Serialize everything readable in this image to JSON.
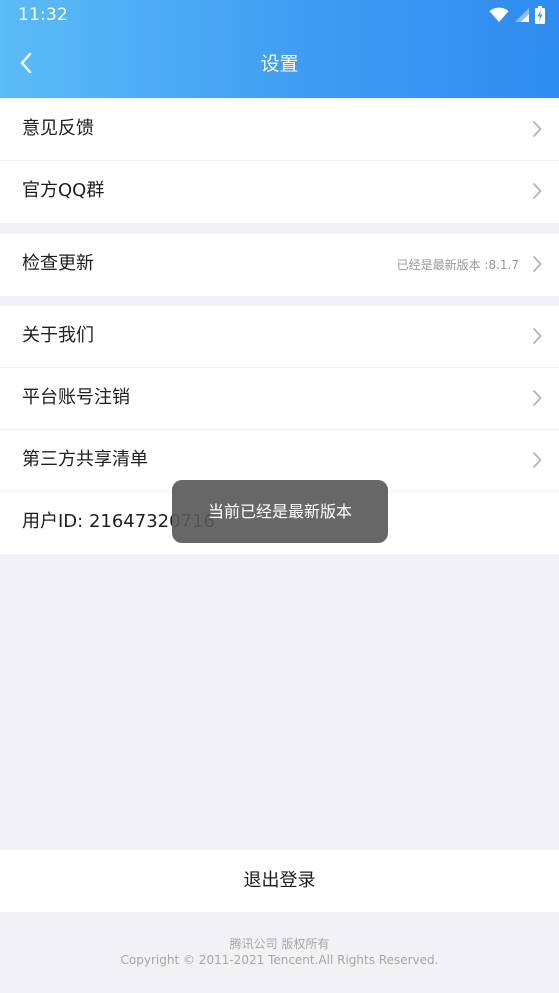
{
  "status_bar": {
    "time": "11:32"
  },
  "header": {
    "title": "设置",
    "back_icon": "chevron-left-icon"
  },
  "groups": [
    {
      "items": [
        {
          "label": "意见反馈"
        },
        {
          "label": "官方QQ群"
        }
      ]
    },
    {
      "items": [
        {
          "label": "检查更新",
          "value": "已经是最新版本 :8.1.7"
        }
      ]
    },
    {
      "items": [
        {
          "label": "关于我们"
        },
        {
          "label": "平台账号注销"
        },
        {
          "label": "第三方共享清单"
        },
        {
          "label": "用户ID: 21647320716"
        }
      ]
    }
  ],
  "logout": {
    "label": "退出登录"
  },
  "footer": {
    "line1": "腾讯公司 版权所有",
    "line2": "Copyright © 2011-2021 Tencent.All Rights Reserved."
  },
  "toast": {
    "message": "当前已经是最新版本"
  },
  "colors": {
    "header_gradient_start": "#5bbcf7",
    "header_gradient_end": "#2f8cf0",
    "page_background": "#f2f2f6",
    "toast_background": "#5a5a5a"
  }
}
